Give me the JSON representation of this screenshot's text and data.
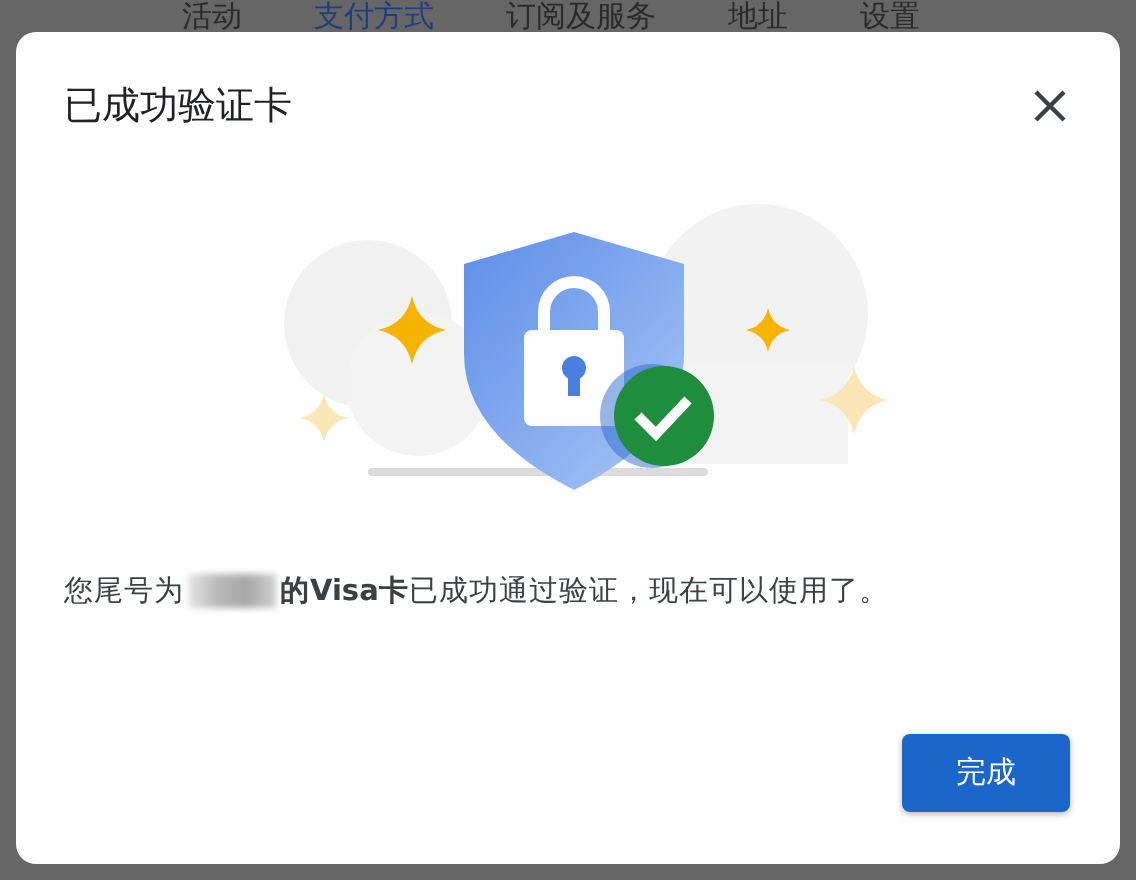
{
  "background_tabs": [
    {
      "label": "活动",
      "selected": false
    },
    {
      "label": "支付方式",
      "selected": true
    },
    {
      "label": "订阅及服务",
      "selected": false
    },
    {
      "label": "地址",
      "selected": false
    },
    {
      "label": "设置",
      "selected": false
    }
  ],
  "dialog": {
    "title": "已成功验证卡",
    "message_prefix": "您尾号为",
    "message_rest": "**的Visa卡**已成功通过验证，现在可以使用了。",
    "button": "完成"
  }
}
